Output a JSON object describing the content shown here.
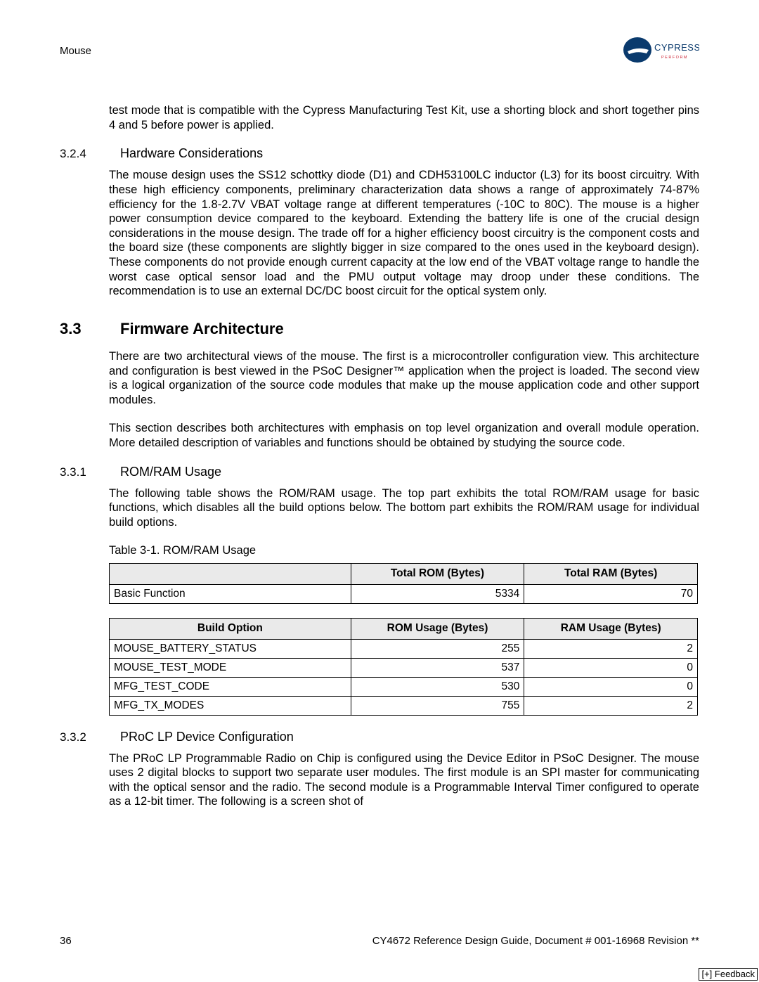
{
  "header": {
    "chapter": "Mouse",
    "logo_brand": "CYPRESS",
    "logo_tag": "P E R F O R M"
  },
  "para_intro": "test mode that is compatible with the Cypress Manufacturing Test Kit, use a shorting block and short together pins 4 and 5 before power is applied.",
  "s324": {
    "num": "3.2.4",
    "title": "Hardware Considerations",
    "body": "The mouse design uses the SS12 schottky diode (D1) and CDH53100LC inductor (L3) for its boost circuitry. With these high efficiency components, preliminary characterization data shows a range of approximately 74-87% efficiency for the 1.8-2.7V VBAT voltage range at different temperatures (-10C to 80C). The mouse is a higher power consumption device compared to the keyboard. Extending the battery life is one of the crucial design considerations in the mouse design. The trade off for a higher efficiency boost circuitry is the component costs and the board size (these components are slightly bigger in size compared to the ones used in the keyboard design). These components do not provide enough current capacity at the low end of the VBAT voltage range to handle the worst case optical sensor load and the PMU output voltage may droop under these conditions. The recommendation is to use an external DC/DC boost circuit for the optical system only."
  },
  "s33": {
    "num": "3.3",
    "title": "Firmware Architecture",
    "p1": "There are two architectural views of the mouse. The first is a microcontroller configuration view. This architecture and configuration is best viewed in the PSoC Designer™ application when the project is loaded. The second view is a logical organization of the source code modules that make up the mouse application code and other support modules.",
    "p2": "This section describes both architectures with emphasis on top level organization and overall module operation. More detailed description of variables and functions should be obtained by studying the source code."
  },
  "s331": {
    "num": "3.3.1",
    "title": "ROM/RAM Usage",
    "body": "The following table shows the ROM/RAM usage. The top part exhibits the total ROM/RAM usage for basic functions, which disables all the build options below. The bottom part exhibits the ROM/RAM usage for individual build options.",
    "table_caption": "Table 3-1.  ROM/RAM Usage"
  },
  "table1": {
    "headers": [
      "",
      "Total ROM (Bytes)",
      "Total RAM (Bytes)"
    ],
    "rows": [
      {
        "name": "Basic Function",
        "rom": "5334",
        "ram": "70"
      }
    ]
  },
  "table2": {
    "headers": [
      "Build Option",
      "ROM Usage (Bytes)",
      "RAM Usage (Bytes)"
    ],
    "rows": [
      {
        "name": "MOUSE_BATTERY_STATUS",
        "rom": "255",
        "ram": "2"
      },
      {
        "name": "MOUSE_TEST_MODE",
        "rom": "537",
        "ram": "0"
      },
      {
        "name": "MFG_TEST_CODE",
        "rom": "530",
        "ram": "0"
      },
      {
        "name": "MFG_TX_MODES",
        "rom": "755",
        "ram": "2"
      }
    ]
  },
  "s332": {
    "num": "3.3.2",
    "title": "PRoC LP Device Configuration",
    "body": "The PRoC LP Programmable Radio on Chip is configured using the Device Editor in PSoC Designer. The mouse uses 2 digital blocks to support two separate user modules. The first module is an SPI master for communicating with the optical sensor and the radio. The second module is a Programmable Interval Timer configured to operate as a 12-bit timer. The following is a screen shot of"
  },
  "footer": {
    "page": "36",
    "doc": "CY4672 Reference Design Guide, Document # 001-16968 Revision **"
  },
  "feedback": "[+] Feedback"
}
